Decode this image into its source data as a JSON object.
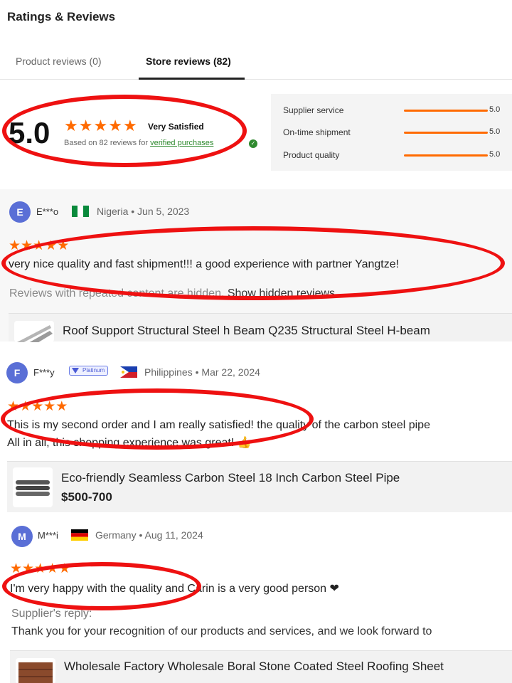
{
  "title": "Ratings & Reviews",
  "tabs": [
    {
      "label": "Product reviews (0)"
    },
    {
      "label": "Store reviews (82)"
    }
  ],
  "summary": {
    "score": "5.0",
    "stars": 5,
    "satisfaction": "Very Satisfied",
    "based_prefix": "Based on 82 reviews for ",
    "verified_text": "verified purchases"
  },
  "ratings": [
    {
      "label": "Supplier service",
      "value": "5.0"
    },
    {
      "label": "On-time shipment",
      "value": "5.0"
    },
    {
      "label": "Product quality",
      "value": "5.0"
    }
  ],
  "reviews": [
    {
      "initial": "E",
      "user": "E***o",
      "country": "Nigeria",
      "date": "Jun 5, 2023",
      "stars": 5,
      "text": "very nice quality and fast shipment!!! a good experience with partner Yangtze!",
      "hidden_note": "Reviews with repeated content are hidden.",
      "show_hidden": "Show hidden reviews",
      "product": {
        "name": "Roof Support Structural Steel h Beam Q235 Structural Steel H-beam"
      }
    },
    {
      "initial": "F",
      "user": "F***y",
      "badge": "Platinum",
      "country": "Philippines",
      "date": "Mar 22, 2024",
      "stars": 5,
      "text_line1": "This is my second order and I am really satisfied! the quality of the carbon steel pipe",
      "text_line2": "All in all, this shopping experience was great! 👍",
      "product": {
        "name": "Eco-friendly Seamless Carbon Steel 18 Inch Carbon Steel Pipe",
        "price": "$500-700"
      }
    },
    {
      "initial": "M",
      "user": "M***i",
      "country": "Germany",
      "date": "Aug 11, 2024",
      "stars": 5,
      "text": "I'm very happy with the quality and Carin is a very good person ❤",
      "supplier_reply_label": "Supplier's reply:",
      "reply": "Thank you for your recognition of our products and services, and we look forward to",
      "product": {
        "name": "Wholesale Factory Wholesale Boral Stone Coated Steel Roofing Sheet"
      }
    }
  ],
  "colors": {
    "star": "#ff6a00",
    "bar": "#ff6a00",
    "verified": "#2f8a2f",
    "annotation": "#ee1111",
    "avatar": "#5a6fd6"
  }
}
